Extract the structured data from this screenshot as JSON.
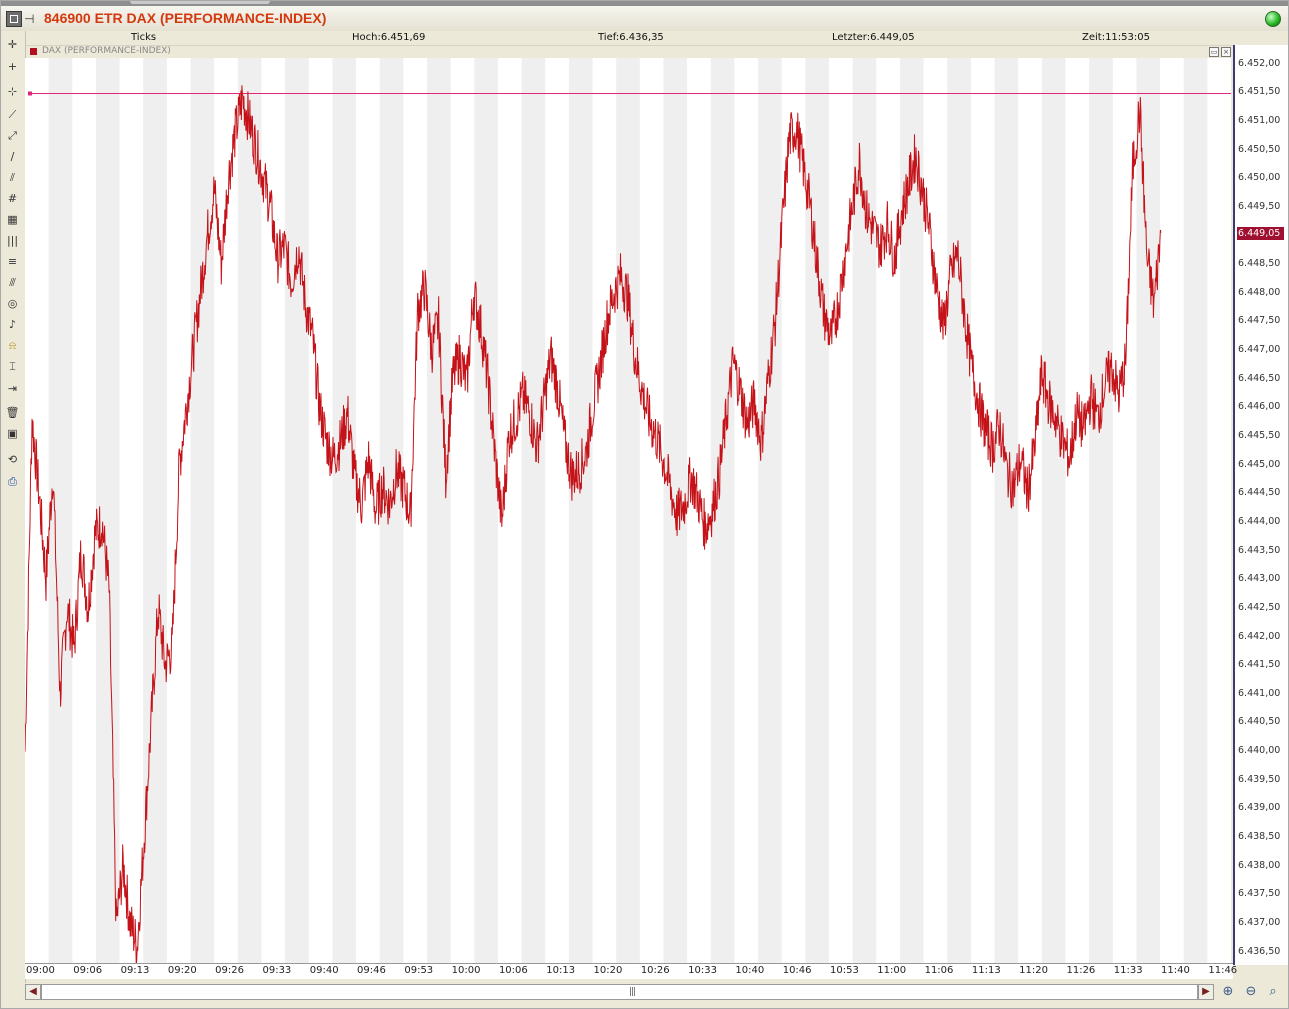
{
  "window": {
    "title": "846900 ETR DAX (PERFORMANCE-INDEX)"
  },
  "infobar": {
    "ticks": "Ticks",
    "high": "Hoch:6.451,69",
    "low": "Tief:6.436,35",
    "last": "Letzter:6.449,05",
    "time": "Zeit:11:53:05"
  },
  "chart_header": {
    "series_label": "DAX (PERFORMANCE-INDEX)"
  },
  "toolbar_icons": [
    "crosshair-icon",
    "cross-icon",
    "move-icon",
    "line-icon",
    "polyline-icon",
    "trendline-icon",
    "parallel-lines-icon",
    "fibonacci-icon",
    "grid-icon",
    "vertical-lines-icon",
    "horizontal-lines-icon",
    "fan-icon",
    "circle-icon",
    "bell-icon",
    "alarm-icon",
    "measure-icon",
    "ruler-icon",
    "delete-icon",
    "save-icon",
    "refresh-icon",
    "print-icon"
  ],
  "chart_data": {
    "type": "line",
    "x_ticks": [
      "09:00",
      "09:06",
      "09:13",
      "09:20",
      "09:26",
      "09:33",
      "09:40",
      "09:46",
      "09:53",
      "10:00",
      "10:06",
      "10:13",
      "10:20",
      "10:26",
      "10:33",
      "10:40",
      "10:46",
      "10:53",
      "11:00",
      "11:06",
      "11:13",
      "11:20",
      "11:26",
      "11:33",
      "11:40",
      "11:46"
    ],
    "y_ticks": [
      "6.452,00",
      "6.451,50",
      "6.451,00",
      "6.450,50",
      "6.450,00",
      "6.449,50",
      "6.449,00",
      "6.448,50",
      "6.448,00",
      "6.447,50",
      "6.447,00",
      "6.446,50",
      "6.446,00",
      "6.445,50",
      "6.445,00",
      "6.444,50",
      "6.444,00",
      "6.443,50",
      "6.443,00",
      "6.442,50",
      "6.442,00",
      "6.441,50",
      "6.441,00",
      "6.440,50",
      "6.440,00",
      "6.439,50",
      "6.439,00",
      "6.438,50",
      "6.438,00",
      "6.437,50",
      "6.437,00",
      "6.436,50"
    ],
    "ylim": [
      6436.3,
      6452.1
    ],
    "x_range_minutes": [
      0,
      172
    ],
    "last_value_label": "6.449,05",
    "last_value": 6449.05,
    "high_line": 6451.48,
    "series": [
      {
        "color": "#c41218",
        "points": [
          [
            0,
            6440
          ],
          [
            1,
            6445.8
          ],
          [
            2,
            6444.5
          ],
          [
            3,
            6443
          ],
          [
            4,
            6444.9
          ],
          [
            5,
            6441
          ],
          [
            6,
            6442.5
          ],
          [
            7,
            6441.8
          ],
          [
            8,
            6443.5
          ],
          [
            9,
            6442.5
          ],
          [
            10,
            6443.8
          ],
          [
            11,
            6444
          ],
          [
            12,
            6442.8
          ],
          [
            13,
            6437
          ],
          [
            14,
            6438
          ],
          [
            15,
            6437
          ],
          [
            16,
            6436.6
          ],
          [
            17,
            6438.5
          ],
          [
            18,
            6440.5
          ],
          [
            19,
            6442.5
          ],
          [
            20,
            6441.5
          ],
          [
            21,
            6441.8
          ],
          [
            22,
            6445
          ],
          [
            23,
            6446
          ],
          [
            24,
            6447
          ],
          [
            25,
            6448
          ],
          [
            26,
            6449
          ],
          [
            27,
            6449.8
          ],
          [
            28,
            6448.5
          ],
          [
            29,
            6450
          ],
          [
            30,
            6450.8
          ],
          [
            31,
            6451.4
          ],
          [
            32,
            6451
          ],
          [
            33,
            6450.5
          ],
          [
            34,
            6450
          ],
          [
            35,
            6449.5
          ],
          [
            36,
            6448.6
          ],
          [
            37,
            6448.8
          ],
          [
            38,
            6448.2
          ],
          [
            39,
            6448.8
          ],
          [
            40,
            6447.8
          ],
          [
            41,
            6447.2
          ],
          [
            42,
            6446
          ],
          [
            43,
            6445.4
          ],
          [
            44,
            6445.1
          ],
          [
            45,
            6445.4
          ],
          [
            46,
            6445.9
          ],
          [
            47,
            6444.8
          ],
          [
            48,
            6444.3
          ],
          [
            49,
            6445.1
          ],
          [
            50,
            6444.2
          ],
          [
            51,
            6444.6
          ],
          [
            52,
            6444.3
          ],
          [
            53,
            6444.9
          ],
          [
            54,
            6444.6
          ],
          [
            55,
            6444.1
          ],
          [
            56,
            6447.7
          ],
          [
            57,
            6448.1
          ],
          [
            58,
            6447
          ],
          [
            59,
            6447.5
          ],
          [
            60,
            6444.8
          ],
          [
            61,
            6446.5
          ],
          [
            62,
            6446.9
          ],
          [
            63,
            6446.4
          ],
          [
            64,
            6448
          ],
          [
            65,
            6447.4
          ],
          [
            66,
            6446.5
          ],
          [
            67,
            6445.2
          ],
          [
            68,
            6444
          ],
          [
            69,
            6445.5
          ],
          [
            70,
            6445.8
          ],
          [
            71,
            6446.2
          ],
          [
            72,
            6445.9
          ],
          [
            73,
            6445.3
          ],
          [
            74,
            6446.1
          ],
          [
            75,
            6446.9
          ],
          [
            76,
            6446.3
          ],
          [
            77,
            6445.4
          ],
          [
            78,
            6444.8
          ],
          [
            79,
            6444.9
          ],
          [
            80,
            6445.2
          ],
          [
            81,
            6446
          ],
          [
            82,
            6446.7
          ],
          [
            83,
            6447.5
          ],
          [
            84,
            6448
          ],
          [
            85,
            6448.3
          ],
          [
            86,
            6447.9
          ],
          [
            87,
            6446.9
          ],
          [
            88,
            6446.3
          ],
          [
            89,
            6445.8
          ],
          [
            90,
            6445.5
          ],
          [
            91,
            6445.1
          ],
          [
            92,
            6444.6
          ],
          [
            93,
            6444.1
          ],
          [
            94,
            6444.3
          ],
          [
            95,
            6444.8
          ],
          [
            96,
            6444.4
          ],
          [
            97,
            6443.9
          ],
          [
            98,
            6444.2
          ],
          [
            99,
            6444.8
          ],
          [
            100,
            6445.8
          ],
          [
            101,
            6446.8
          ],
          [
            102,
            6446.3
          ],
          [
            103,
            6445.7
          ],
          [
            104,
            6446.1
          ],
          [
            105,
            6445.4
          ],
          [
            106,
            6446.5
          ],
          [
            107,
            6447.5
          ],
          [
            108,
            6449.2
          ],
          [
            109,
            6450.7
          ],
          [
            110,
            6450.9
          ],
          [
            111,
            6450.2
          ],
          [
            112,
            6449.5
          ],
          [
            113,
            6448.5
          ],
          [
            114,
            6447.6
          ],
          [
            115,
            6447.2
          ],
          [
            116,
            6447.8
          ],
          [
            117,
            6448.7
          ],
          [
            118,
            6449.5
          ],
          [
            119,
            6450.3
          ],
          [
            120,
            6449.4
          ],
          [
            121,
            6449.1
          ],
          [
            122,
            6448.8
          ],
          [
            123,
            6449.2
          ],
          [
            124,
            6448.6
          ],
          [
            125,
            6449.4
          ],
          [
            126,
            6449.9
          ],
          [
            127,
            6450.4
          ],
          [
            128,
            6449.8
          ],
          [
            129,
            6449.1
          ],
          [
            130,
            6448.1
          ],
          [
            131,
            6447.4
          ],
          [
            132,
            6448.3
          ],
          [
            133,
            6448.7
          ],
          [
            134,
            6447.6
          ],
          [
            135,
            6446.7
          ],
          [
            136,
            6446.1
          ],
          [
            137,
            6445.6
          ],
          [
            138,
            6445.3
          ],
          [
            139,
            6445.7
          ],
          [
            140,
            6444.9
          ],
          [
            141,
            6444.6
          ],
          [
            142,
            6445.1
          ],
          [
            143,
            6444.5
          ],
          [
            144,
            6445.3
          ],
          [
            145,
            6446.6
          ],
          [
            146,
            6446.1
          ],
          [
            147,
            6445.8
          ],
          [
            148,
            6445.4
          ],
          [
            149,
            6445.1
          ],
          [
            150,
            6445.9
          ],
          [
            151,
            6445.6
          ],
          [
            152,
            6446.2
          ],
          [
            153,
            6445.8
          ],
          [
            154,
            6446.4
          ],
          [
            155,
            6446.7
          ],
          [
            156,
            6446.2
          ],
          [
            157,
            6446.8
          ],
          [
            158,
            6450.2
          ],
          [
            159,
            6451.2
          ],
          [
            160,
            6448.6
          ],
          [
            161,
            6447.8
          ],
          [
            162,
            6449.05
          ]
        ]
      }
    ]
  }
}
